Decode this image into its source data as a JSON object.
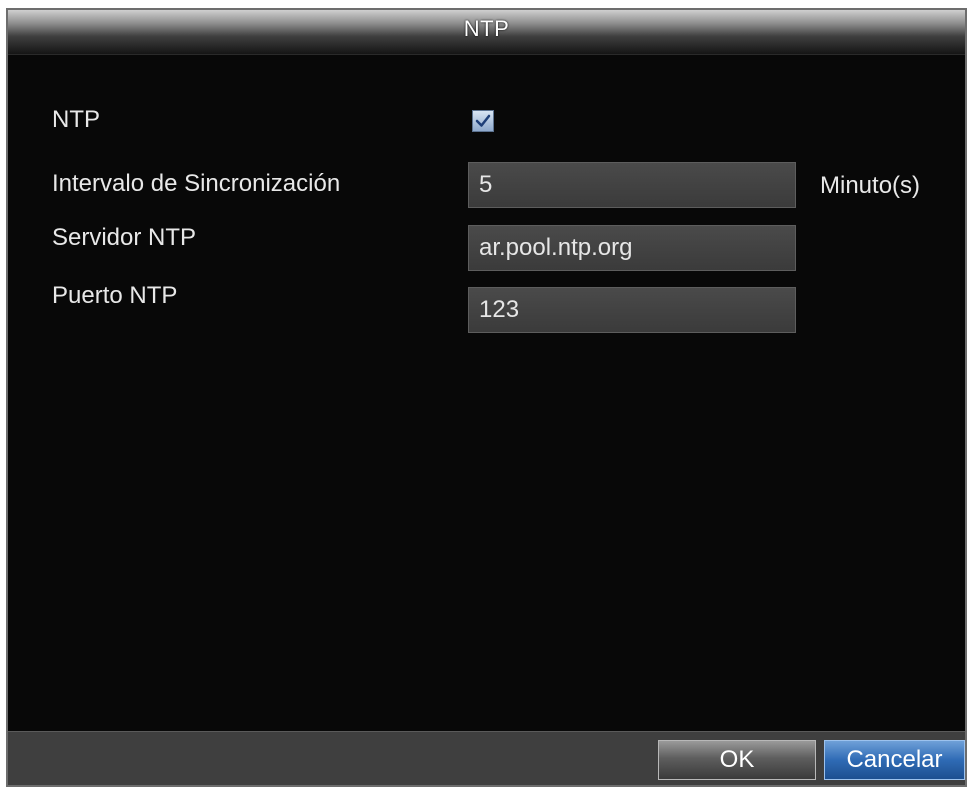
{
  "dialog": {
    "title": "NTP"
  },
  "form": {
    "ntp_label": "NTP",
    "ntp_enabled": true,
    "interval_label": "Intervalo de Sincronización",
    "interval_value": "5",
    "interval_unit": "Minuto(s)",
    "server_label": "Servidor NTP",
    "server_value": "ar.pool.ntp.org",
    "port_label": "Puerto NTP",
    "port_value": "123"
  },
  "buttons": {
    "ok_label": "OK",
    "cancel_label": "Cancelar"
  },
  "colors": {
    "background": "#080808",
    "field": "#424242",
    "accent_button": "#2f6bb5",
    "text": "#e8e8e8"
  },
  "icons": {
    "checkbox": "checkmark-icon"
  }
}
